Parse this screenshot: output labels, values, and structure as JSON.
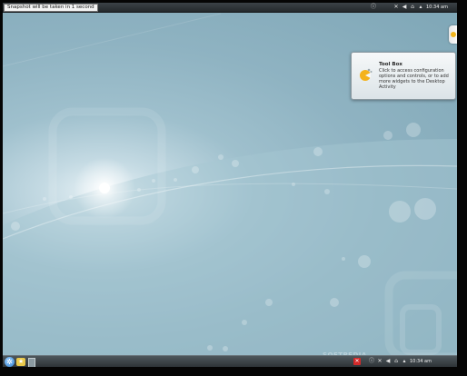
{
  "top_panel": {
    "snapshot_notice": "Snapshot will be taken in 1 second",
    "clock": "10:34 am"
  },
  "tooltip": {
    "title": "Tool Box",
    "body": "Click to access configuration options and controls, or to add more widgets to the Desktop Activity"
  },
  "bottom_panel": {
    "clock": "10:34 am"
  },
  "watermark": {
    "text": "SOFTPEDIA",
    "subtext": "www.softpedia.com"
  },
  "colors": {
    "wallpaper": "#8fb3c2",
    "panel": "#2b3135",
    "accent_blue": "#2f7fd0",
    "close_red": "#d22a2a"
  },
  "icons": {
    "kickoff": "kde-gear-icon",
    "folder": "folder-icon",
    "toolbox": "cashew-icon",
    "tray": [
      "info-icon",
      "network-icon",
      "volume-icon",
      "home-icon",
      "arrow-up-icon"
    ]
  }
}
